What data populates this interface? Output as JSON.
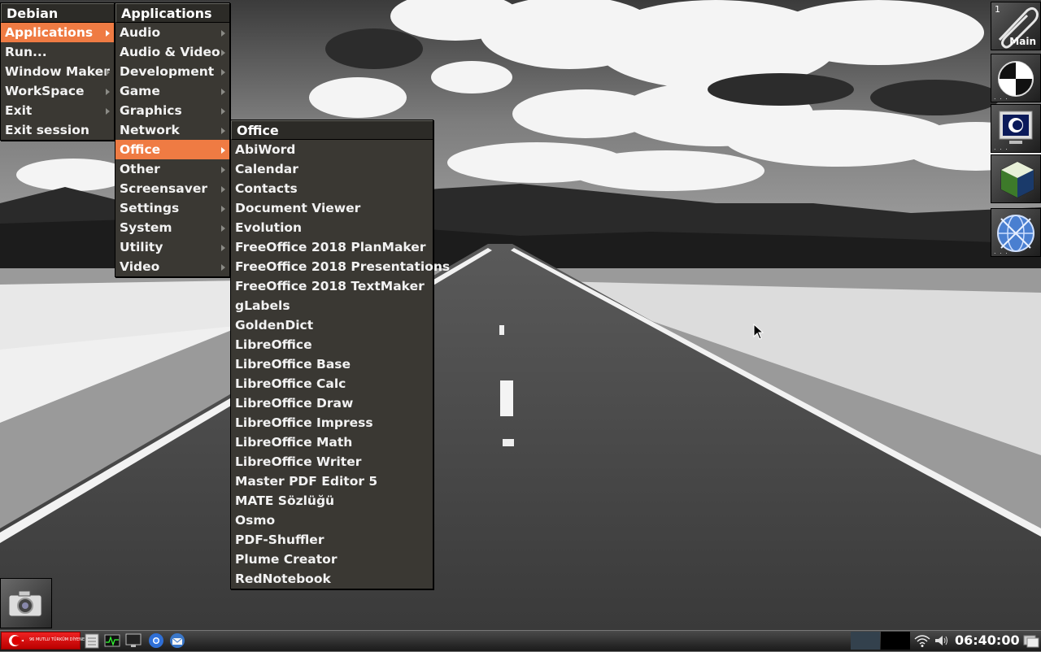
{
  "root_menu": {
    "title": "Debian",
    "items": [
      {
        "label": "Applications",
        "submenu": true,
        "active": true
      },
      {
        "label": "Run...",
        "submenu": false
      },
      {
        "label": "Window Maker",
        "submenu": true
      },
      {
        "label": "WorkSpace",
        "submenu": true
      },
      {
        "label": "Exit",
        "submenu": true
      },
      {
        "label": "Exit session",
        "submenu": false
      }
    ]
  },
  "apps_menu": {
    "title": "Applications",
    "items": [
      {
        "label": "Audio",
        "submenu": true
      },
      {
        "label": "Audio & Video",
        "submenu": true
      },
      {
        "label": "Development",
        "submenu": true
      },
      {
        "label": "Game",
        "submenu": true
      },
      {
        "label": "Graphics",
        "submenu": true
      },
      {
        "label": "Network",
        "submenu": true
      },
      {
        "label": "Office",
        "submenu": true,
        "active": true
      },
      {
        "label": "Other",
        "submenu": true
      },
      {
        "label": "Screensaver",
        "submenu": true
      },
      {
        "label": "Settings",
        "submenu": true
      },
      {
        "label": "System",
        "submenu": true
      },
      {
        "label": "Utility",
        "submenu": true
      },
      {
        "label": "Video",
        "submenu": true
      }
    ]
  },
  "office_menu": {
    "title": "Office",
    "items": [
      "AbiWord",
      "Calendar",
      "Contacts",
      "Document Viewer",
      "Evolution",
      "FreeOffice 2018 PlanMaker",
      "FreeOffice 2018 Presentations",
      "FreeOffice 2018 TextMaker",
      "gLabels",
      "GoldenDict",
      "LibreOffice",
      "LibreOffice Base",
      "LibreOffice Calc",
      "LibreOffice Draw",
      "LibreOffice Impress",
      "LibreOffice Math",
      "LibreOffice Writer",
      "Master PDF Editor 5",
      "MATE Sözlüğü",
      "Osmo",
      "PDF-Shuffler",
      "Plume Creator",
      "RedNotebook"
    ]
  },
  "dock": {
    "clip_workspace_number": "1",
    "clip_workspace_name": "Main",
    "icons": [
      "paperclip-icon",
      "display-settings-icon",
      "terminal-monitor-icon",
      "package-cube-icon",
      "web-browser-globe-icon"
    ]
  },
  "miniwindow": {
    "icon": "camera-icon"
  },
  "panel": {
    "start_flag_text": "96 MUTLU TÜRKÜM DİYENE",
    "launchers": [
      "file-manager-icon",
      "system-monitor-icon",
      "monitor-icon",
      "chromium-icon",
      "thunderbird-icon"
    ],
    "tray": [
      "wifi-icon",
      "volume-icon"
    ],
    "clock": "06:40:00",
    "show_desktop_icon": "show-desktop-icon"
  },
  "colors": {
    "menu_bg": "#3a3833",
    "menu_title_bg": "#2c2b27",
    "highlight": "#ef7b43",
    "menu_text": "#f2f2f2"
  }
}
